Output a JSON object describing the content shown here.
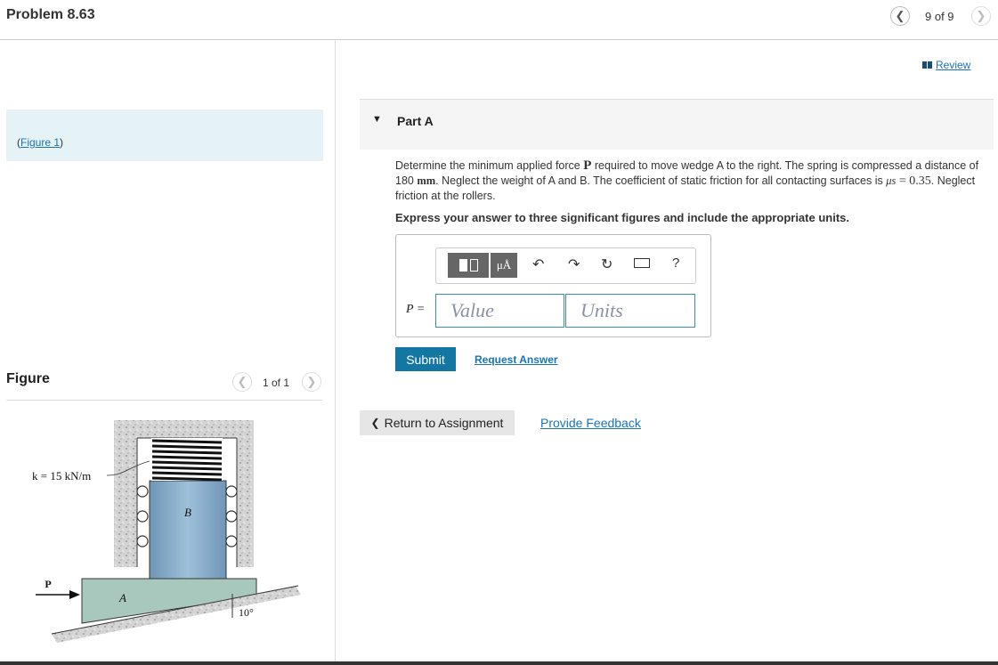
{
  "header": {
    "problem_title": "Problem 8.63",
    "page_count": "9 of 9"
  },
  "review_link": "Review",
  "figure_link": "Figure 1",
  "figure_panel": {
    "title": "Figure",
    "page_count": "1 of 1",
    "labels": {
      "spring": "k = 15 kN/m",
      "block_b": "B",
      "wedge_a": "A",
      "force": "P",
      "angle": "10°"
    }
  },
  "part_a": {
    "label": "Part A",
    "problem_text_1": "Determine the minimum applied force ",
    "force_symbol": "P",
    "problem_text_2": " required to move wedge A to the right. The spring is compressed a distance of 180 ",
    "unit_mm": "mm",
    "problem_text_3": ". Neglect the weight of A and B. The coefficient of static friction for all contacting surfaces is ",
    "mu_symbol": "μs",
    "mu_value": " = 0.35",
    "problem_text_4": ". Neglect friction at the rollers.",
    "instruction": "Express your answer to three significant figures and include the appropriate units.",
    "variable_label": "P =",
    "value_placeholder": "Value",
    "units_placeholder": "Units",
    "toolbar": {
      "units_symbol": "μÅ",
      "help": "?"
    },
    "submit_label": "Submit",
    "request_answer_label": "Request Answer"
  },
  "footer": {
    "return_label": "Return to Assignment",
    "feedback_label": "Provide Feedback"
  },
  "colors": {
    "accent": "#1477a3",
    "link": "#1a73b5",
    "figure_highlight": "#e5f3f7"
  }
}
